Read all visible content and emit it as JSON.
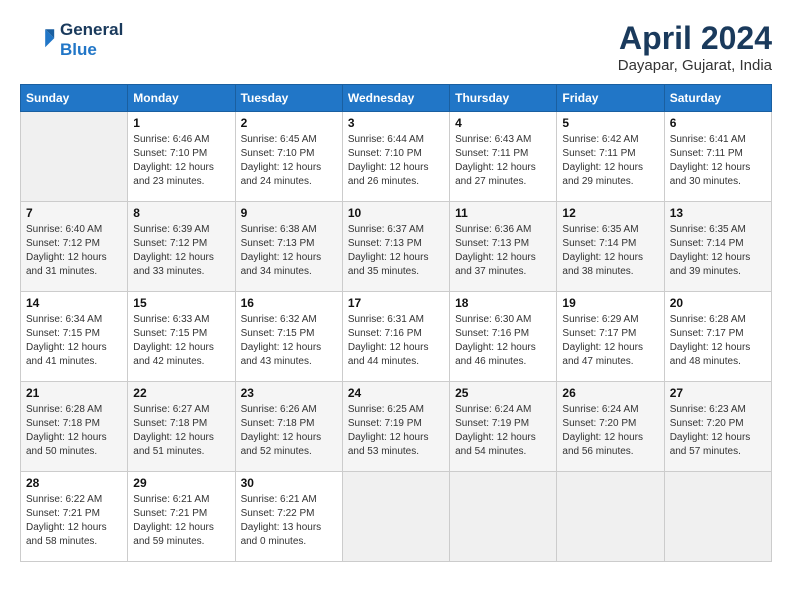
{
  "logo": {
    "line1": "General",
    "line2": "Blue"
  },
  "title": "April 2024",
  "location": "Dayapar, Gujarat, India",
  "weekdays": [
    "Sunday",
    "Monday",
    "Tuesday",
    "Wednesday",
    "Thursday",
    "Friday",
    "Saturday"
  ],
  "weeks": [
    [
      {
        "day": "",
        "empty": true
      },
      {
        "day": "1",
        "sunrise": "Sunrise: 6:46 AM",
        "sunset": "Sunset: 7:10 PM",
        "daylight": "Daylight: 12 hours and 23 minutes."
      },
      {
        "day": "2",
        "sunrise": "Sunrise: 6:45 AM",
        "sunset": "Sunset: 7:10 PM",
        "daylight": "Daylight: 12 hours and 24 minutes."
      },
      {
        "day": "3",
        "sunrise": "Sunrise: 6:44 AM",
        "sunset": "Sunset: 7:10 PM",
        "daylight": "Daylight: 12 hours and 26 minutes."
      },
      {
        "day": "4",
        "sunrise": "Sunrise: 6:43 AM",
        "sunset": "Sunset: 7:11 PM",
        "daylight": "Daylight: 12 hours and 27 minutes."
      },
      {
        "day": "5",
        "sunrise": "Sunrise: 6:42 AM",
        "sunset": "Sunset: 7:11 PM",
        "daylight": "Daylight: 12 hours and 29 minutes."
      },
      {
        "day": "6",
        "sunrise": "Sunrise: 6:41 AM",
        "sunset": "Sunset: 7:11 PM",
        "daylight": "Daylight: 12 hours and 30 minutes."
      }
    ],
    [
      {
        "day": "7",
        "sunrise": "Sunrise: 6:40 AM",
        "sunset": "Sunset: 7:12 PM",
        "daylight": "Daylight: 12 hours and 31 minutes."
      },
      {
        "day": "8",
        "sunrise": "Sunrise: 6:39 AM",
        "sunset": "Sunset: 7:12 PM",
        "daylight": "Daylight: 12 hours and 33 minutes."
      },
      {
        "day": "9",
        "sunrise": "Sunrise: 6:38 AM",
        "sunset": "Sunset: 7:13 PM",
        "daylight": "Daylight: 12 hours and 34 minutes."
      },
      {
        "day": "10",
        "sunrise": "Sunrise: 6:37 AM",
        "sunset": "Sunset: 7:13 PM",
        "daylight": "Daylight: 12 hours and 35 minutes."
      },
      {
        "day": "11",
        "sunrise": "Sunrise: 6:36 AM",
        "sunset": "Sunset: 7:13 PM",
        "daylight": "Daylight: 12 hours and 37 minutes."
      },
      {
        "day": "12",
        "sunrise": "Sunrise: 6:35 AM",
        "sunset": "Sunset: 7:14 PM",
        "daylight": "Daylight: 12 hours and 38 minutes."
      },
      {
        "day": "13",
        "sunrise": "Sunrise: 6:35 AM",
        "sunset": "Sunset: 7:14 PM",
        "daylight": "Daylight: 12 hours and 39 minutes."
      }
    ],
    [
      {
        "day": "14",
        "sunrise": "Sunrise: 6:34 AM",
        "sunset": "Sunset: 7:15 PM",
        "daylight": "Daylight: 12 hours and 41 minutes."
      },
      {
        "day": "15",
        "sunrise": "Sunrise: 6:33 AM",
        "sunset": "Sunset: 7:15 PM",
        "daylight": "Daylight: 12 hours and 42 minutes."
      },
      {
        "day": "16",
        "sunrise": "Sunrise: 6:32 AM",
        "sunset": "Sunset: 7:15 PM",
        "daylight": "Daylight: 12 hours and 43 minutes."
      },
      {
        "day": "17",
        "sunrise": "Sunrise: 6:31 AM",
        "sunset": "Sunset: 7:16 PM",
        "daylight": "Daylight: 12 hours and 44 minutes."
      },
      {
        "day": "18",
        "sunrise": "Sunrise: 6:30 AM",
        "sunset": "Sunset: 7:16 PM",
        "daylight": "Daylight: 12 hours and 46 minutes."
      },
      {
        "day": "19",
        "sunrise": "Sunrise: 6:29 AM",
        "sunset": "Sunset: 7:17 PM",
        "daylight": "Daylight: 12 hours and 47 minutes."
      },
      {
        "day": "20",
        "sunrise": "Sunrise: 6:28 AM",
        "sunset": "Sunset: 7:17 PM",
        "daylight": "Daylight: 12 hours and 48 minutes."
      }
    ],
    [
      {
        "day": "21",
        "sunrise": "Sunrise: 6:28 AM",
        "sunset": "Sunset: 7:18 PM",
        "daylight": "Daylight: 12 hours and 50 minutes."
      },
      {
        "day": "22",
        "sunrise": "Sunrise: 6:27 AM",
        "sunset": "Sunset: 7:18 PM",
        "daylight": "Daylight: 12 hours and 51 minutes."
      },
      {
        "day": "23",
        "sunrise": "Sunrise: 6:26 AM",
        "sunset": "Sunset: 7:18 PM",
        "daylight": "Daylight: 12 hours and 52 minutes."
      },
      {
        "day": "24",
        "sunrise": "Sunrise: 6:25 AM",
        "sunset": "Sunset: 7:19 PM",
        "daylight": "Daylight: 12 hours and 53 minutes."
      },
      {
        "day": "25",
        "sunrise": "Sunrise: 6:24 AM",
        "sunset": "Sunset: 7:19 PM",
        "daylight": "Daylight: 12 hours and 54 minutes."
      },
      {
        "day": "26",
        "sunrise": "Sunrise: 6:24 AM",
        "sunset": "Sunset: 7:20 PM",
        "daylight": "Daylight: 12 hours and 56 minutes."
      },
      {
        "day": "27",
        "sunrise": "Sunrise: 6:23 AM",
        "sunset": "Sunset: 7:20 PM",
        "daylight": "Daylight: 12 hours and 57 minutes."
      }
    ],
    [
      {
        "day": "28",
        "sunrise": "Sunrise: 6:22 AM",
        "sunset": "Sunset: 7:21 PM",
        "daylight": "Daylight: 12 hours and 58 minutes."
      },
      {
        "day": "29",
        "sunrise": "Sunrise: 6:21 AM",
        "sunset": "Sunset: 7:21 PM",
        "daylight": "Daylight: 12 hours and 59 minutes."
      },
      {
        "day": "30",
        "sunrise": "Sunrise: 6:21 AM",
        "sunset": "Sunset: 7:22 PM",
        "daylight": "Daylight: 13 hours and 0 minutes."
      },
      {
        "day": "",
        "empty": true
      },
      {
        "day": "",
        "empty": true
      },
      {
        "day": "",
        "empty": true
      },
      {
        "day": "",
        "empty": true
      }
    ]
  ]
}
